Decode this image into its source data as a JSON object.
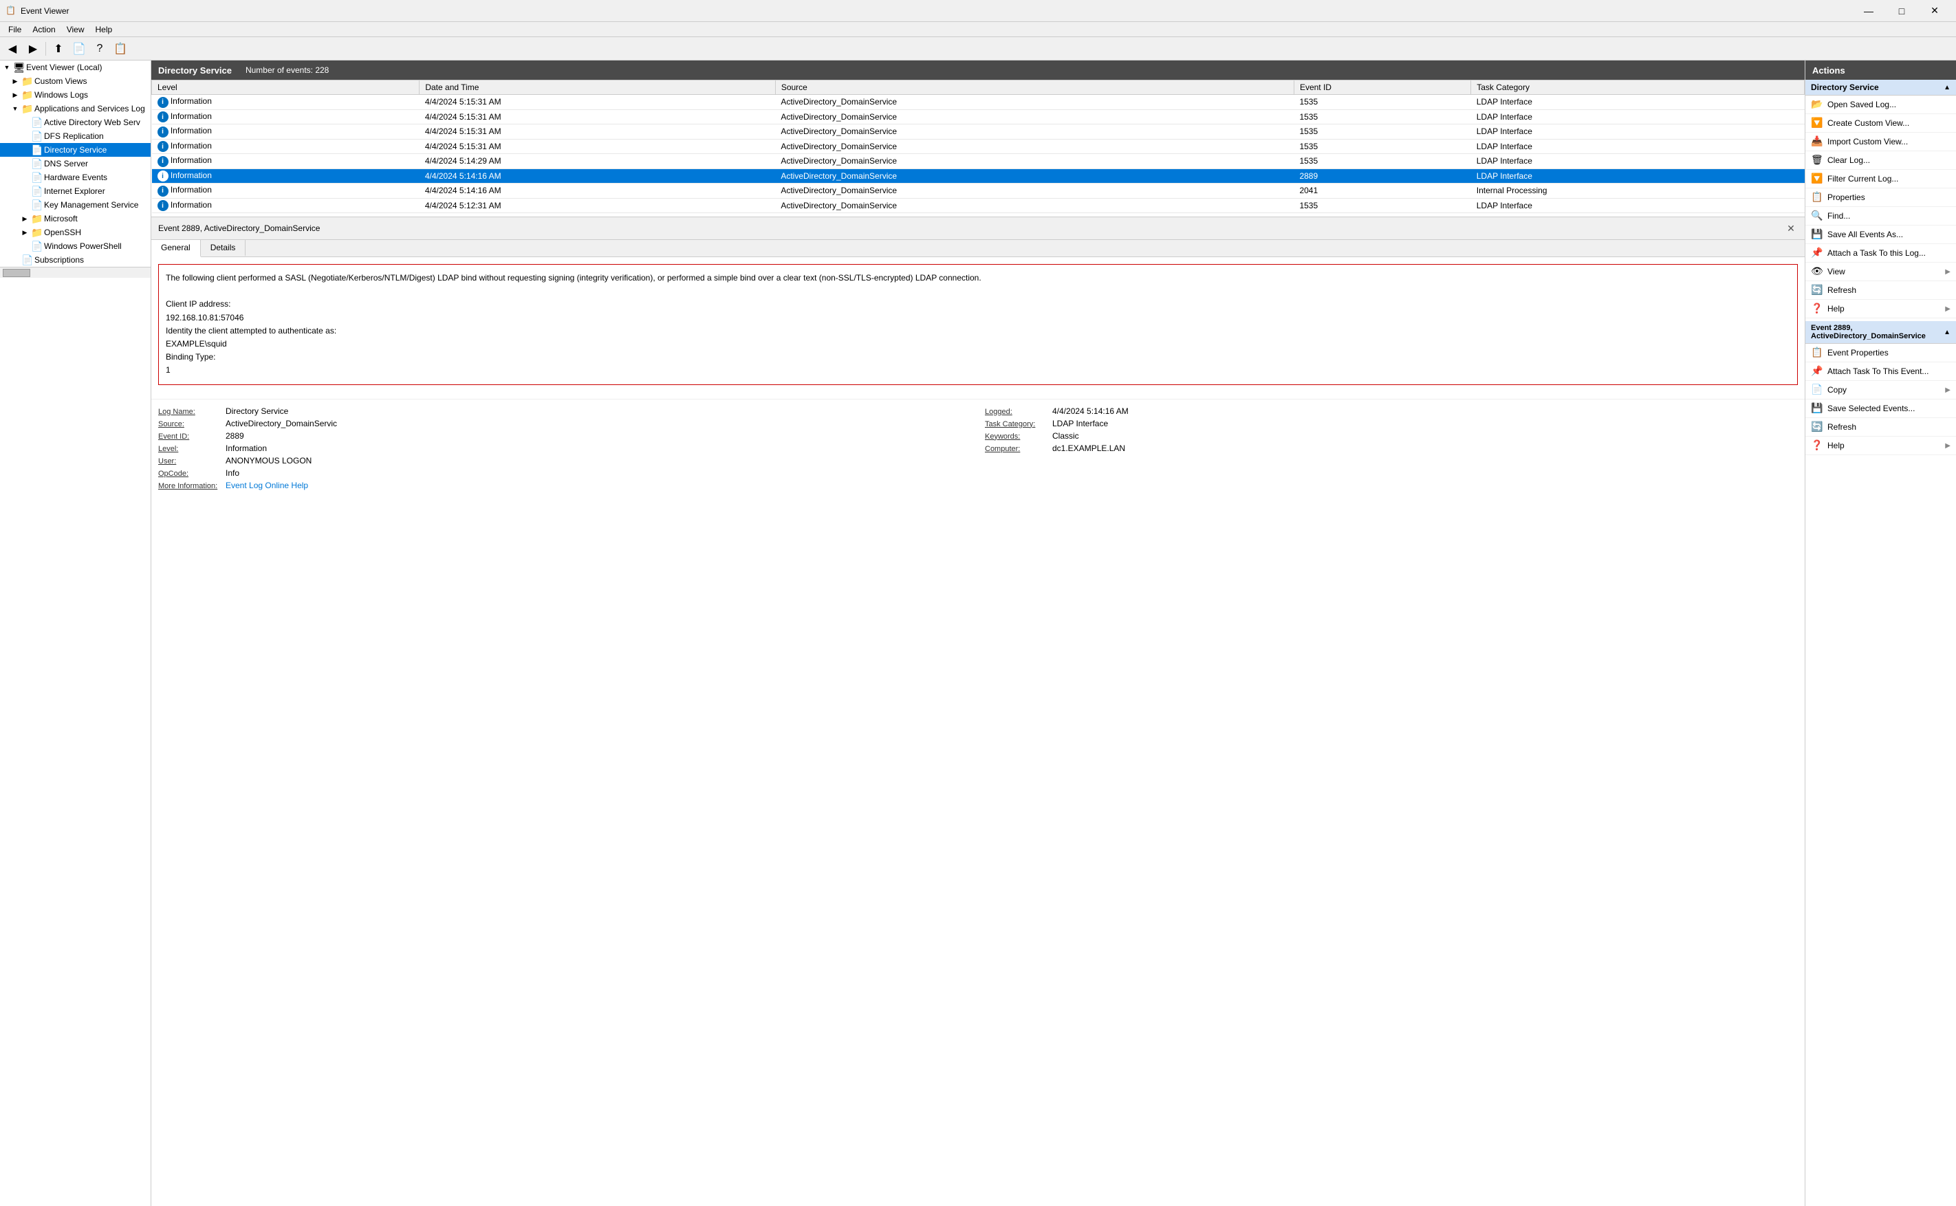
{
  "window": {
    "title": "Event Viewer",
    "icon": "📋"
  },
  "titlebar": {
    "minimize": "—",
    "maximize": "□",
    "close": "✕"
  },
  "menubar": {
    "items": [
      "File",
      "Action",
      "View",
      "Help"
    ]
  },
  "toolbar": {
    "buttons": [
      "◀",
      "▶",
      "⬆",
      "📄",
      "?",
      "📋"
    ]
  },
  "sidebar": {
    "root_label": "Event Viewer (Local)",
    "items": [
      {
        "label": "Custom Views",
        "indent": 1,
        "expandable": true,
        "expanded": false
      },
      {
        "label": "Windows Logs",
        "indent": 1,
        "expandable": true,
        "expanded": false
      },
      {
        "label": "Applications and Services Log",
        "indent": 1,
        "expandable": true,
        "expanded": true
      },
      {
        "label": "Active Directory Web Serv",
        "indent": 2,
        "expandable": false
      },
      {
        "label": "DFS Replication",
        "indent": 2,
        "expandable": false
      },
      {
        "label": "Directory Service",
        "indent": 2,
        "expandable": false,
        "selected": true
      },
      {
        "label": "DNS Server",
        "indent": 2,
        "expandable": false
      },
      {
        "label": "Hardware Events",
        "indent": 2,
        "expandable": false
      },
      {
        "label": "Internet Explorer",
        "indent": 2,
        "expandable": false
      },
      {
        "label": "Key Management Service",
        "indent": 2,
        "expandable": false
      },
      {
        "label": "Microsoft",
        "indent": 2,
        "expandable": true,
        "expanded": false
      },
      {
        "label": "OpenSSH",
        "indent": 2,
        "expandable": true,
        "expanded": false
      },
      {
        "label": "Windows PowerShell",
        "indent": 2,
        "expandable": false
      },
      {
        "label": "Subscriptions",
        "indent": 1,
        "expandable": false
      }
    ]
  },
  "log_header": {
    "title": "Directory Service",
    "event_count_label": "Number of events: 228"
  },
  "table": {
    "columns": [
      "Level",
      "Date and Time",
      "Source",
      "Event ID",
      "Task Category"
    ],
    "rows": [
      {
        "icon": "i",
        "level": "Information",
        "datetime": "4/4/2024 5:15:31 AM",
        "source": "ActiveDirectory_DomainService",
        "event_id": "1535",
        "task": "LDAP Interface",
        "selected": false
      },
      {
        "icon": "i",
        "level": "Information",
        "datetime": "4/4/2024 5:15:31 AM",
        "source": "ActiveDirectory_DomainService",
        "event_id": "1535",
        "task": "LDAP Interface",
        "selected": false
      },
      {
        "icon": "i",
        "level": "Information",
        "datetime": "4/4/2024 5:15:31 AM",
        "source": "ActiveDirectory_DomainService",
        "event_id": "1535",
        "task": "LDAP Interface",
        "selected": false
      },
      {
        "icon": "i",
        "level": "Information",
        "datetime": "4/4/2024 5:15:31 AM",
        "source": "ActiveDirectory_DomainService",
        "event_id": "1535",
        "task": "LDAP Interface",
        "selected": false
      },
      {
        "icon": "i",
        "level": "Information",
        "datetime": "4/4/2024 5:14:29 AM",
        "source": "ActiveDirectory_DomainService",
        "event_id": "1535",
        "task": "LDAP Interface",
        "selected": false
      },
      {
        "icon": "i",
        "level": "Information",
        "datetime": "4/4/2024 5:14:16 AM",
        "source": "ActiveDirectory_DomainService",
        "event_id": "2889",
        "task": "LDAP Interface",
        "selected": true
      },
      {
        "icon": "i",
        "level": "Information",
        "datetime": "4/4/2024 5:14:16 AM",
        "source": "ActiveDirectory_DomainService",
        "event_id": "2041",
        "task": "Internal Processing",
        "selected": false
      },
      {
        "icon": "i",
        "level": "Information",
        "datetime": "4/4/2024 5:12:31 AM",
        "source": "ActiveDirectory_DomainService",
        "event_id": "1535",
        "task": "LDAP Interface",
        "selected": false
      }
    ]
  },
  "event_detail": {
    "header": "Event 2889, ActiveDirectory_DomainService",
    "tabs": [
      "General",
      "Details"
    ],
    "active_tab": "General",
    "message": "The following client performed a SASL (Negotiate/Kerberos/NTLM/Digest) LDAP bind without requesting signing (integrity verification), or performed a simple bind over a clear text (non-SSL/TLS-encrypted) LDAP connection.\n\nClient IP address:\n192.168.10.81:57046\nIdentity the client attempted to authenticate as:\nEXAMPLE\\squid\nBinding Type:\n1",
    "fields": {
      "log_name_label": "Log Name:",
      "log_name_value": "Directory Service",
      "source_label": "Source:",
      "source_value": "ActiveDirectory_DomainServic",
      "logged_label": "Logged:",
      "logged_value": "4/4/2024 5:14:16 AM",
      "event_id_label": "Event ID:",
      "event_id_value": "2889",
      "task_category_label": "Task Category:",
      "task_category_value": "LDAP Interface",
      "level_label": "Level:",
      "level_value": "Information",
      "keywords_label": "Keywords:",
      "keywords_value": "Classic",
      "user_label": "User:",
      "user_value": "ANONYMOUS LOGON",
      "computer_label": "Computer:",
      "computer_value": "dc1.EXAMPLE.LAN",
      "opcode_label": "OpCode:",
      "opcode_value": "Info",
      "more_info_label": "More Information:",
      "more_info_link": "Event Log Online Help"
    }
  },
  "actions": {
    "header": "Actions",
    "section1": {
      "title": "Directory Service",
      "items": [
        {
          "icon": "📂",
          "label": "Open Saved Log..."
        },
        {
          "icon": "🔽",
          "label": "Create Custom View..."
        },
        {
          "icon": "📥",
          "label": "Import Custom View..."
        },
        {
          "icon": "🗑",
          "label": "Clear Log..."
        },
        {
          "icon": "🔽",
          "label": "Filter Current Log..."
        },
        {
          "icon": "📋",
          "label": "Properties"
        },
        {
          "icon": "🔍",
          "label": "Find..."
        },
        {
          "icon": "💾",
          "label": "Save All Events As..."
        },
        {
          "icon": "📌",
          "label": "Attach a Task To this Log..."
        },
        {
          "icon": "👁",
          "label": "View",
          "arrow": "▶"
        },
        {
          "icon": "🔄",
          "label": "Refresh"
        },
        {
          "icon": "❓",
          "label": "Help",
          "arrow": "▶"
        }
      ]
    },
    "section2": {
      "title": "Event 2889, ActiveDirectory_DomainService",
      "items": [
        {
          "icon": "📋",
          "label": "Event Properties"
        },
        {
          "icon": "📌",
          "label": "Attach Task To This Event..."
        },
        {
          "icon": "📄",
          "label": "Copy",
          "arrow": "▶"
        },
        {
          "icon": "💾",
          "label": "Save Selected Events..."
        },
        {
          "icon": "🔄",
          "label": "Refresh"
        },
        {
          "icon": "❓",
          "label": "Help",
          "arrow": "▶"
        }
      ]
    }
  }
}
